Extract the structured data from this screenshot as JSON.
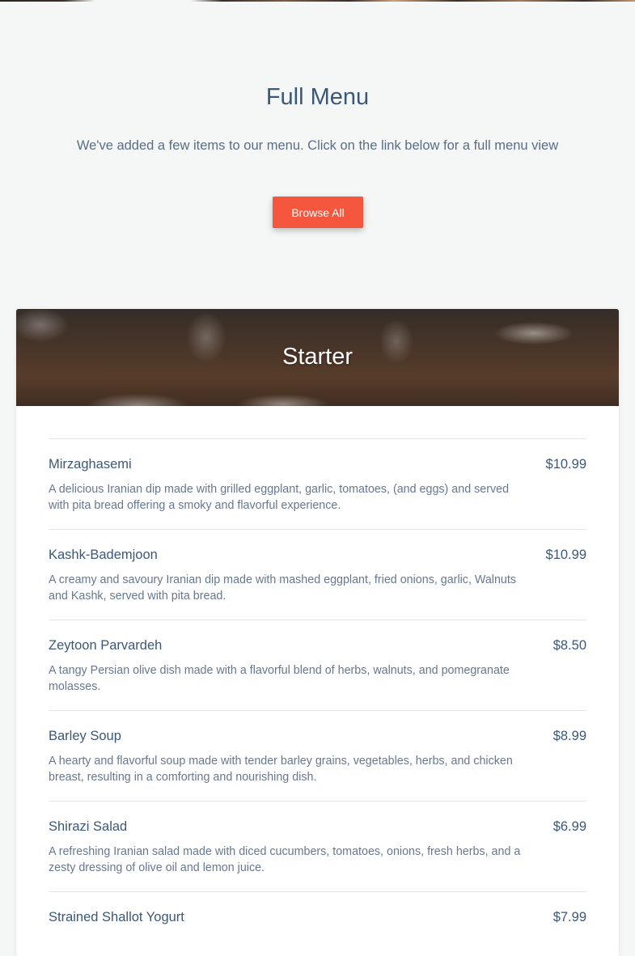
{
  "intro": {
    "title": "Full Menu",
    "subtitle": "We've added a few items to our menu. Click on the link below for a full menu view",
    "button_label": "Browse All"
  },
  "section": {
    "title": "Starter",
    "items": [
      {
        "name": "Mirzaghasemi",
        "price": "$10.99",
        "description": "A delicious Iranian dip made with grilled eggplant, garlic, tomatoes, (and eggs) and served with pita bread offering a smoky and flavorful experience."
      },
      {
        "name": "Kashk-Bademjoon",
        "price": "$10.99",
        "description": "A creamy and savoury Iranian dip made with mashed eggplant, fried onions, garlic, Walnuts and Kashk, served with pita bread."
      },
      {
        "name": "Zeytoon Parvardeh",
        "price": "$8.50",
        "description": "A tangy Persian olive dish made with a flavorful blend of herbs, walnuts, and pomegranate molasses."
      },
      {
        "name": "Barley Soup",
        "price": "$8.99",
        "description": "A hearty and flavorful soup made with tender barley grains, vegetables, herbs, and chicken breast, resulting in a comforting and nourishing dish."
      },
      {
        "name": "Shirazi Salad",
        "price": "$6.99",
        "description": "A refreshing Iranian salad made with diced cucumbers, tomatoes, onions, fresh herbs, and a zesty dressing of olive oil and lemon juice."
      },
      {
        "name": "Strained Shallot Yogurt",
        "price": "$7.99",
        "description": ""
      }
    ]
  },
  "colors": {
    "background": "#f5f6f6",
    "accent": "#f4573d",
    "heading": "#3b5878",
    "body_text": "#667890"
  }
}
